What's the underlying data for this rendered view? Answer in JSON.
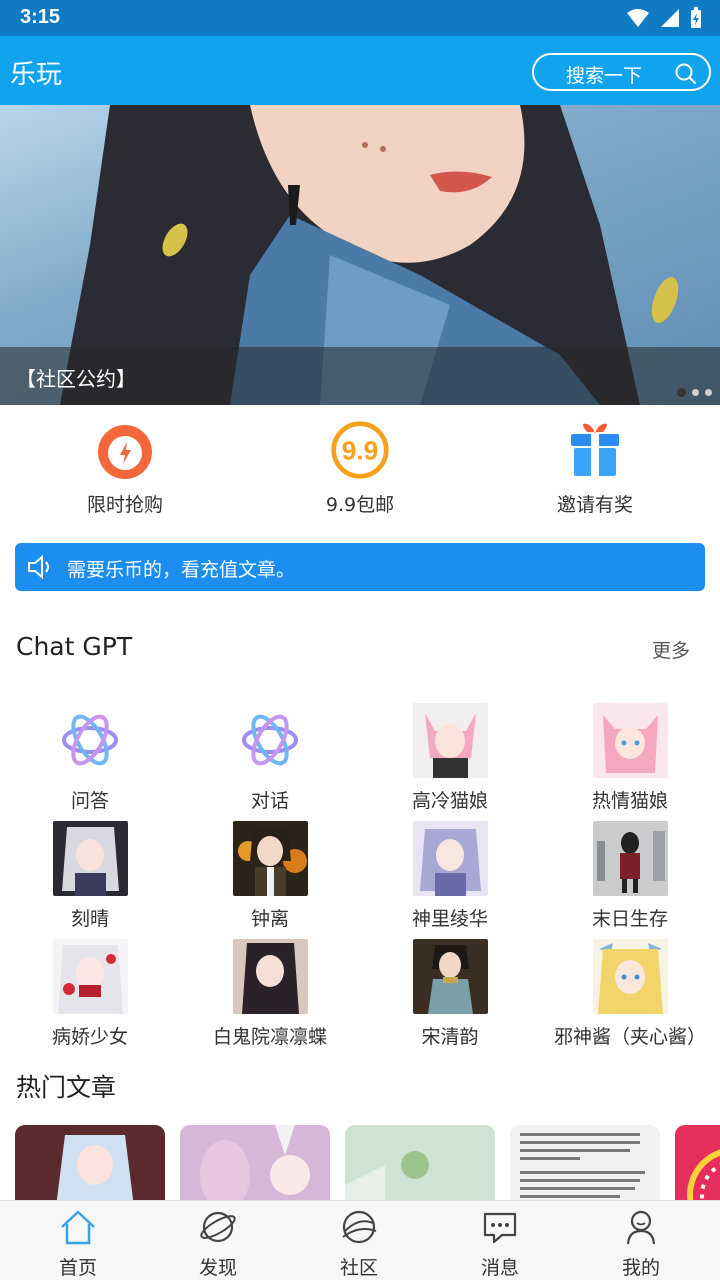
{
  "status_bar": {
    "time": "3:15"
  },
  "header": {
    "title": "乐玩",
    "search_label": "搜索一下"
  },
  "banner": {
    "caption": "【社区公约】",
    "slide_count": 3,
    "active_slide": 1
  },
  "quick_actions": [
    {
      "label": "限时抢购",
      "icon": "alarm-clock-icon"
    },
    {
      "label": "9.9包邮",
      "icon": "nine-nine-badge-icon"
    },
    {
      "label": "邀请有奖",
      "icon": "gift-icon"
    }
  ],
  "notice": {
    "text": "需要乐币的，看充值文章。",
    "icon": "speaker-icon"
  },
  "chatgpt": {
    "title": "Chat GPT",
    "more_label": "更多",
    "bots": [
      {
        "label": "问答",
        "avatar": "openai-logo"
      },
      {
        "label": "对话",
        "avatar": "openai-logo"
      },
      {
        "label": "高冷猫娘",
        "avatar": "anime-portrait"
      },
      {
        "label": "热情猫娘",
        "avatar": "anime-portrait"
      },
      {
        "label": "刻晴",
        "avatar": "anime-portrait"
      },
      {
        "label": "钟离",
        "avatar": "anime-portrait"
      },
      {
        "label": "神里绫华",
        "avatar": "anime-portrait"
      },
      {
        "label": "末日生存",
        "avatar": "anime-portrait"
      },
      {
        "label": "病娇少女",
        "avatar": "anime-portrait"
      },
      {
        "label": "白鬼院凛凛蝶",
        "avatar": "anime-portrait"
      },
      {
        "label": "宋清韵",
        "avatar": "anime-portrait"
      },
      {
        "label": "邪神酱（夹心酱）",
        "avatar": "anime-portrait"
      }
    ]
  },
  "hot_articles": {
    "title": "热门文章"
  },
  "bottom_nav": [
    {
      "label": "首页",
      "icon": "home-icon",
      "active": true
    },
    {
      "label": "发现",
      "icon": "planet-icon"
    },
    {
      "label": "社区",
      "icon": "globe-icon"
    },
    {
      "label": "消息",
      "icon": "chat-bubble-icon"
    },
    {
      "label": "我的",
      "icon": "user-icon"
    }
  ],
  "colors": {
    "primary": "#11a3ee",
    "status_bar": "#0e7bc4",
    "notice": "#1b8ef0",
    "nav_active": "#3aa3e8"
  }
}
